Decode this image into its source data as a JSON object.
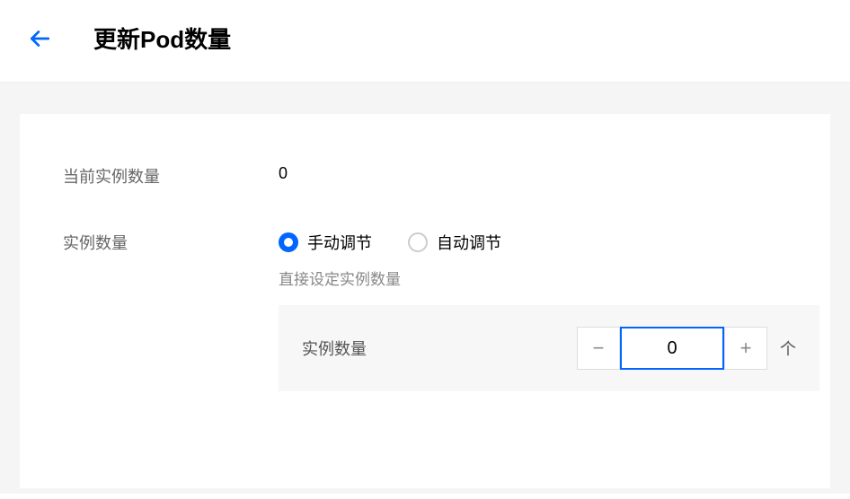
{
  "header": {
    "title": "更新Pod数量"
  },
  "form": {
    "currentCount": {
      "label": "当前实例数量",
      "value": "0"
    },
    "instanceCount": {
      "label": "实例数量",
      "radios": {
        "manual": "手动调节",
        "auto": "自动调节"
      },
      "hint": "直接设定实例数量",
      "box": {
        "label": "实例数量",
        "value": "0",
        "unit": "个"
      }
    }
  }
}
